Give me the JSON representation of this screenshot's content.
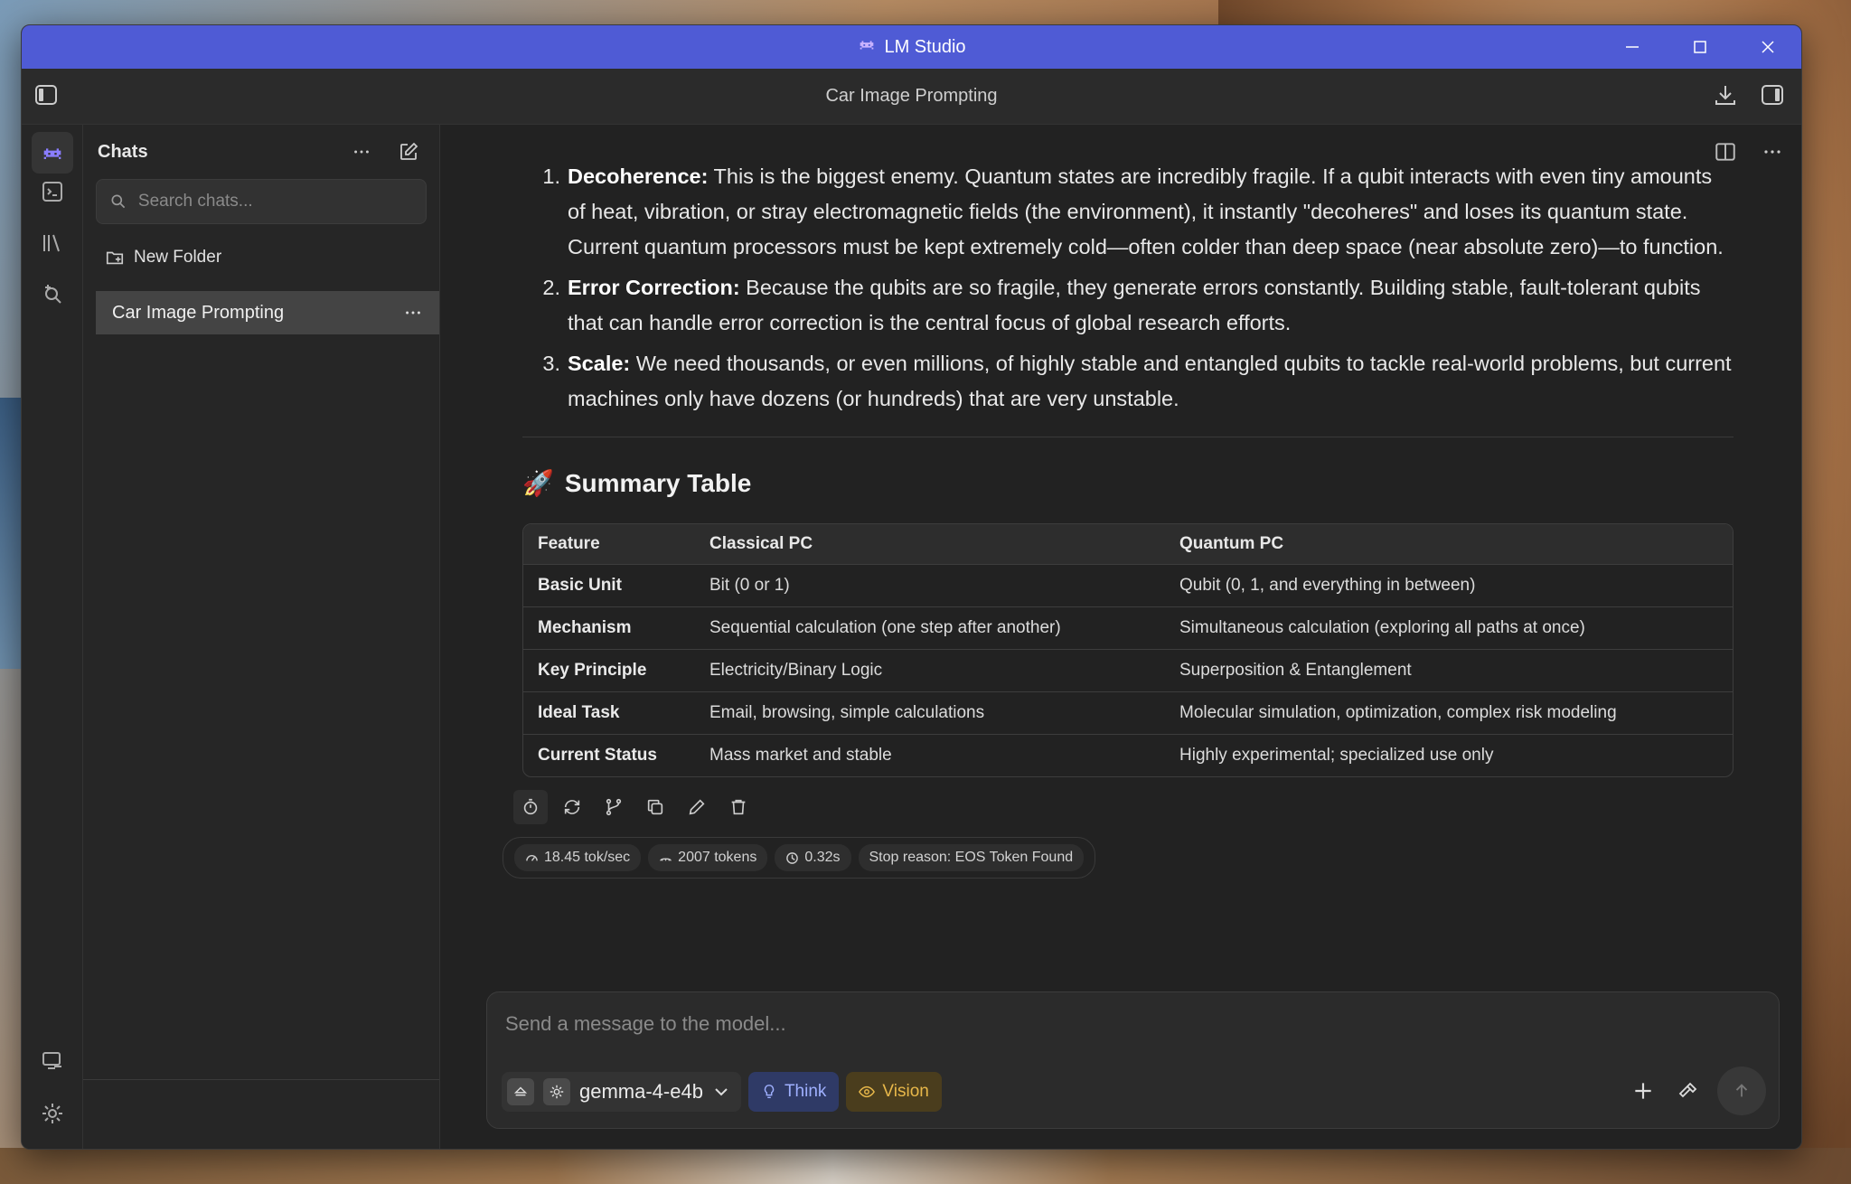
{
  "window": {
    "app_title": "LM Studio",
    "chat_title": "Car Image Prompting"
  },
  "sidebar": {
    "header": "Chats",
    "search_placeholder": "Search chats...",
    "new_folder": "New Folder",
    "chats": [
      {
        "label": "Car Image Prompting"
      }
    ]
  },
  "message": {
    "points": [
      {
        "num": "1.",
        "term": "Decoherence:",
        "text": " This is the biggest enemy. Quantum states are incredibly fragile. If a qubit interacts with even tiny amounts of heat, vibration, or stray electromagnetic fields (the environment), it instantly \"decoheres\" and loses its quantum state. Current quantum processors must be kept extremely cold—often colder than deep space (near absolute zero)—to function."
      },
      {
        "num": "2.",
        "term": "Error Correction:",
        "text": " Because the qubits are so fragile, they generate errors constantly. Building stable, fault-tolerant qubits that can handle error correction is the central focus of global research efforts."
      },
      {
        "num": "3.",
        "term": "Scale:",
        "text": " We need thousands, or even millions, of highly stable and entangled qubits to tackle real-world problems, but current machines only have dozens (or hundreds) that are very unstable."
      }
    ],
    "summary_heading": "Summary Table",
    "summary_emoji": "🚀",
    "table": {
      "headers": [
        "Feature",
        "Classical PC",
        "Quantum PC"
      ],
      "rows": [
        [
          "Basic Unit",
          "Bit (0 or 1)",
          "Qubit (0, 1, and everything in between)"
        ],
        [
          "Mechanism",
          "Sequential calculation (one step after another)",
          "Simultaneous calculation (exploring all paths at once)"
        ],
        [
          "Key Principle",
          "Electricity/Binary Logic",
          "Superposition & Entanglement"
        ],
        [
          "Ideal Task",
          "Email, browsing, simple calculations",
          "Molecular simulation, optimization, complex risk modeling"
        ],
        [
          "Current Status",
          "Mass market and stable",
          "Highly experimental; specialized use only"
        ]
      ]
    }
  },
  "stats": {
    "speed": "18.45 tok/sec",
    "tokens": "2007 tokens",
    "time": "0.32s",
    "stop": "Stop reason: EOS Token Found"
  },
  "composer": {
    "placeholder": "Send a message to the model...",
    "model": "gemma-4-e4b",
    "think": "Think",
    "vision": "Vision"
  },
  "colors": {
    "titlebar": "#4f5bd5",
    "accent_think": "#9fb0ff",
    "accent_vision": "#e8b84a"
  }
}
